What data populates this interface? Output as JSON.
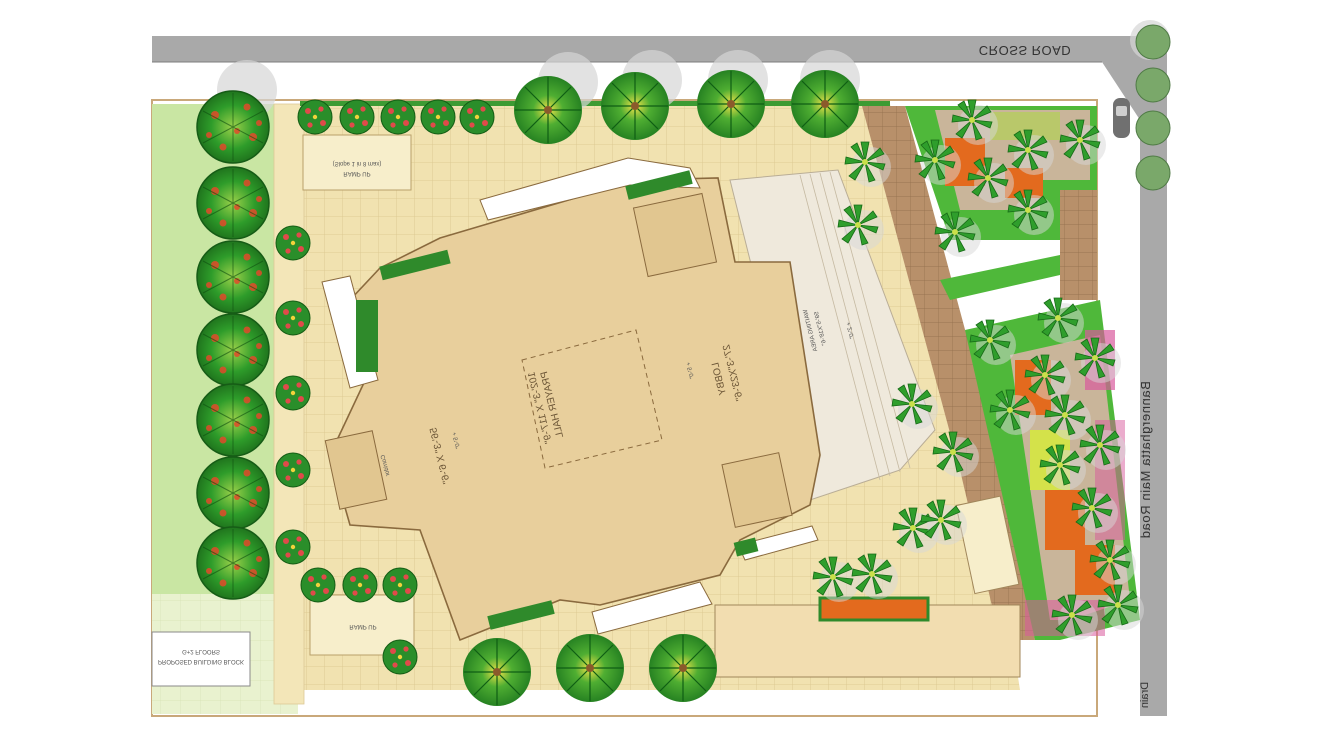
{
  "roads": {
    "cross_road": "CROSS ROAD",
    "main_road": "Bannerghatta Main Road",
    "drain": "Drain"
  },
  "buildings": {
    "prayer_hall": "PRAYER HALL",
    "prayer_hall_size": "102'-3\" X 117'-9\"",
    "prayer_hall_level": "+ 5'-0\"",
    "lobby": "LOBBY",
    "lobby_size": "27'-3\"X23'-6\"",
    "lobby_level": "+ 5'-0\"",
    "hall_size_2": "56'-3\" X 6'-6\"",
    "hall_level_2": "+ 5'-0\"",
    "corridor": "Corridor",
    "waiting_area": "WAITING AREA",
    "waiting_size": "59'-5\"X18'-6\"",
    "waiting_level": "+ 2'-0\"",
    "ramp_up_top": "RAMP UP",
    "ramp_up_top_note": "(Slope 1 in 8 max)",
    "ramp_up_bottom": "RAMP UP",
    "proposed_building": "PROPOSED BUILDING BLOCK",
    "proposed_building_note": "G+2 FLOORS"
  },
  "colors": {
    "road": "#a8a8a8",
    "lawn": "#c9e6a3",
    "paving": "#f1e2b0",
    "hall": "#e8cf9c",
    "hedge": "#2f8a2b",
    "grass": "#4fb83a",
    "brown_paving": "#b08a5f",
    "flower_orange": "#e36a1e",
    "flower_pink": "#d85a9c"
  }
}
